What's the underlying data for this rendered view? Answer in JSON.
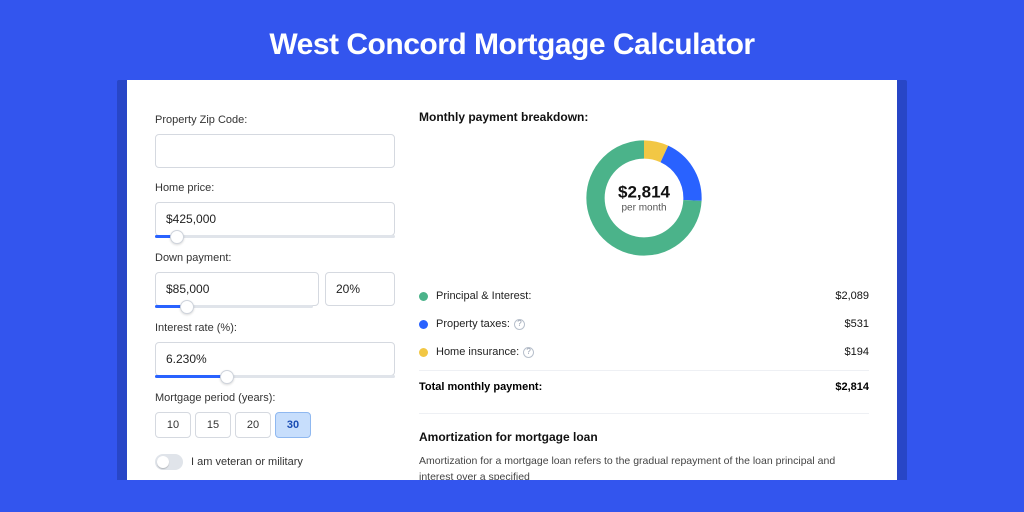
{
  "title": "West Concord Mortgage Calculator",
  "colors": {
    "principal": "#4bb38a",
    "taxes": "#2962ff",
    "insurance": "#f2c744"
  },
  "form": {
    "zip_label": "Property Zip Code:",
    "zip_value": "",
    "home_price_label": "Home price:",
    "home_price_value": "$425,000",
    "home_price_slider_pct": 9,
    "down_payment_label": "Down payment:",
    "down_payment_value": "$85,000",
    "down_payment_pct_value": "20%",
    "down_payment_slider_pct": 20,
    "interest_label": "Interest rate (%):",
    "interest_value": "6.230%",
    "interest_slider_pct": 30,
    "period_label": "Mortgage period (years):",
    "period_options": [
      "10",
      "15",
      "20",
      "30"
    ],
    "period_selected": "30",
    "veteran_label": "I am veteran or military"
  },
  "breakdown": {
    "header": "Monthly payment breakdown:",
    "center_amount": "$2,814",
    "center_sub": "per month",
    "items": [
      {
        "label": "Principal & Interest:",
        "value": "$2,089",
        "color_key": "principal",
        "info": false,
        "num": 2089
      },
      {
        "label": "Property taxes:",
        "value": "$531",
        "color_key": "taxes",
        "info": true,
        "num": 531
      },
      {
        "label": "Home insurance:",
        "value": "$194",
        "color_key": "insurance",
        "info": true,
        "num": 194
      }
    ],
    "total_label": "Total monthly payment:",
    "total_value": "$2,814",
    "total_num": 2814
  },
  "amortization": {
    "header": "Amortization for mortgage loan",
    "text": "Amortization for a mortgage loan refers to the gradual repayment of the loan principal and interest over a specified"
  },
  "chart_data": {
    "type": "pie",
    "title": "Monthly payment breakdown",
    "categories": [
      "Principal & Interest",
      "Property taxes",
      "Home insurance"
    ],
    "values": [
      2089,
      531,
      194
    ],
    "colors": [
      "#4bb38a",
      "#2962ff",
      "#f2c744"
    ],
    "total": 2814,
    "center_label": "$2,814 per month"
  }
}
